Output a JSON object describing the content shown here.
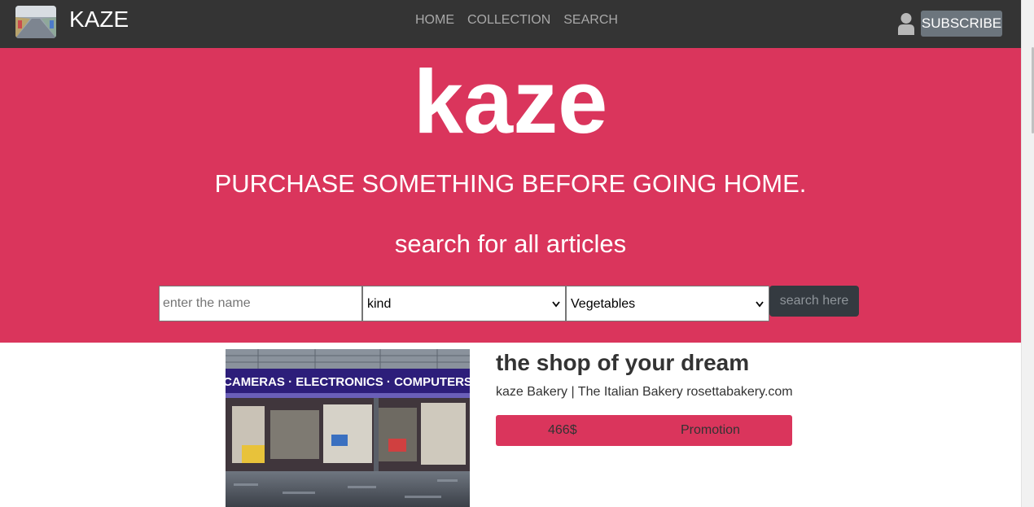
{
  "navbar": {
    "brand": "KAZE",
    "links": [
      "HOME",
      "COLLECTION",
      "SEARCH"
    ],
    "subscribe_label": "SUBSCRIBE",
    "bg_color": "#343434"
  },
  "hero": {
    "title": "kaze",
    "subtitle": "PURCHASE SOMETHING BEFORE GOING HOME.",
    "search_title": "search for all articles",
    "bg_color": "#da355c",
    "search": {
      "name_placeholder": "enter the name",
      "kind_value": "kind",
      "category_value": "Vegetables",
      "button_label": "search here"
    }
  },
  "card": {
    "image_sign": "CAMERAS · ELECTRONICS · COMPUTERS",
    "title": "the shop of your dream",
    "description": "kaze Bakery | The Italian Bakery rosettabakery.com",
    "price": "466$",
    "promotion": "Promotion"
  }
}
